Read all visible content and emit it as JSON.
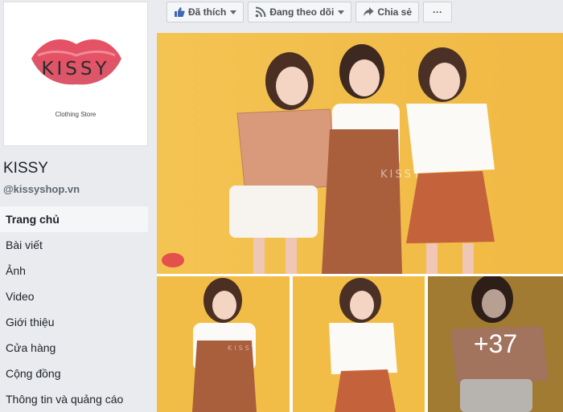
{
  "page": {
    "name": "KISSY",
    "handle": "@kissyshop.vn",
    "logo": {
      "brand": "KISSY",
      "tagline": "Clothing Store"
    }
  },
  "nav": [
    {
      "label": "Trang chủ",
      "active": true
    },
    {
      "label": "Bài viết"
    },
    {
      "label": "Ảnh"
    },
    {
      "label": "Video"
    },
    {
      "label": "Giới thiệu"
    },
    {
      "label": "Cửa hàng"
    },
    {
      "label": "Cộng đồng"
    },
    {
      "label": "Thông tin và quảng cáo"
    }
  ],
  "actions": {
    "liked": "Đã thích",
    "following": "Đang theo dõi",
    "share": "Chia sẻ",
    "more": "···"
  },
  "photos": {
    "watermark": "KISSY",
    "more_count": "+37"
  },
  "colors": {
    "brand_red": "#e0334a",
    "fb_blue": "#4267b2",
    "backdrop_yellow": "#f2bd47"
  }
}
